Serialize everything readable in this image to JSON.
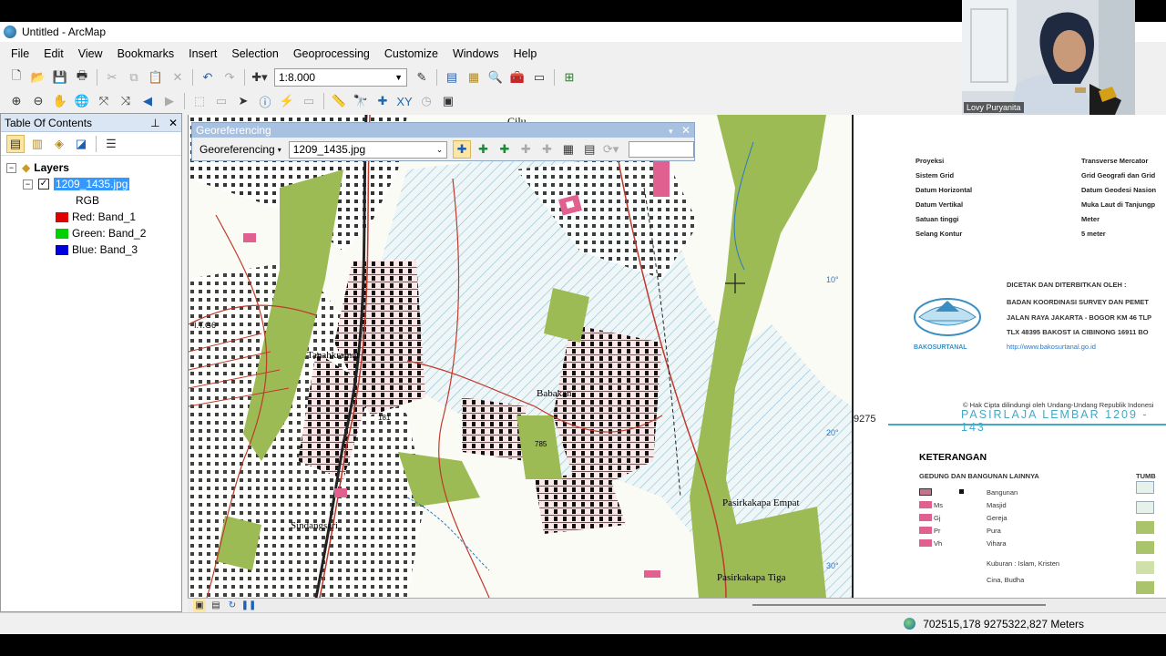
{
  "window": {
    "title": "Untitled - ArcMap"
  },
  "menu": [
    "File",
    "Edit",
    "View",
    "Bookmarks",
    "Insert",
    "Selection",
    "Geoprocessing",
    "Customize",
    "Windows",
    "Help"
  ],
  "toolbar": {
    "scale": "1:8.000"
  },
  "toc": {
    "title": "Table Of Contents",
    "root": "Layers",
    "layer": "1209_1435.jpg",
    "rgb_label": "RGB",
    "bands": [
      {
        "label": "Red:  Band_1",
        "color": "#e00000"
      },
      {
        "label": "Green: Band_2",
        "color": "#00d000"
      },
      {
        "label": "Blue:  Band_3",
        "color": "#0000dd"
      }
    ]
  },
  "georef": {
    "title": "Georeferencing",
    "menu_label": "Georeferencing",
    "layer": "1209_1435.jpg"
  },
  "map_labels": {
    "places": [
      "Cilu",
      "Tanahkramat",
      "Babakan",
      "Sindangsari",
      "Pasirkakapa Empat",
      "Pasirkakapa Tiga"
    ],
    "numbers": [
      "181",
      "785"
    ],
    "grid": [
      "10°",
      "20°",
      "30°",
      "9275",
      "I.T.G6"
    ]
  },
  "legend": {
    "info": [
      {
        "k": "Proyeksi",
        "v": "Transverse Mercator"
      },
      {
        "k": "Sistem Grid",
        "v": "Grid Geografi dan Grid"
      },
      {
        "k": "Datum Horizontal",
        "v": "Datum Geodesi Nasion"
      },
      {
        "k": "Datum Vertikal",
        "v": "Muka Laut di Tanjungp"
      },
      {
        "k": "Satuan tinggi",
        "v": "Meter"
      },
      {
        "k": "Selang Kontur",
        "v": "5 meter"
      }
    ],
    "publisher": [
      "DICETAK DAN DITERBITKAN OLEH :",
      "BADAN KOORDINASI SURVEY DAN PEMET",
      "JALAN RAYA JAKARTA - BOGOR KM 46 TLP",
      "TLX 48395 BAKOST IA CIBINONG 16911 BO"
    ],
    "url": "http://www.bakosurtanal.go.id",
    "logo_text": "BAKOSURTANAL",
    "copyright": "© Hak Cipta dilindungi oleh Undang-Undang Republik Indonesi",
    "sheet": "PASIRLAJA   LEMBAR  1209 - 143",
    "keterangan": "KETERANGAN",
    "subhead": "GEDUNG DAN BANGUNAN LAINNYA",
    "right_head": "TUMB",
    "items": [
      "Bangunan",
      "Masjid",
      "Gereja",
      "Pura",
      "Vihara",
      "Kuburan : Islam, Kristen",
      "Cina, Budha"
    ],
    "codes": [
      "Ms",
      "Gj",
      "Pr",
      "Vh"
    ]
  },
  "status": {
    "coords": "702515,178  9275322,827 Meters"
  },
  "webcam": {
    "name": "Lovy Puryanita"
  }
}
